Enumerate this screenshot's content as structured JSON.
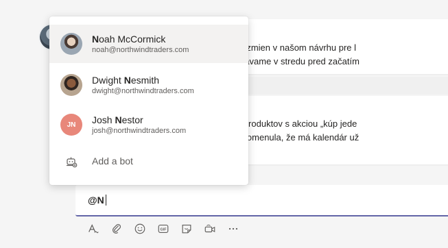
{
  "messages": {
    "line1": "ient mal niekoľko zmien v našom návrhu pre l",
    "line2": "ěto úpravy vykonávame v stredu pred začatím",
    "line3": "ody majú sekciu produktov s akciou „kúp jede",
    "line4": "ala august, ale spomenula, že má kalendár už"
  },
  "mention_popup": {
    "people": [
      {
        "name_bold": "N",
        "name_rest": "oah McCormick",
        "email": "noah@northwindtraders.com",
        "selected": true
      },
      {
        "name_pre": "Dwight ",
        "name_bold": "N",
        "name_rest": "esmith",
        "email": "dwight@northwindtraders.com"
      },
      {
        "name_pre": "Josh ",
        "name_bold": "N",
        "name_rest": "estor",
        "email": "josh@northwindtraders.com",
        "initials": "JN"
      }
    ],
    "add_bot_label": "Add a bot"
  },
  "compose": {
    "text": "@N"
  },
  "toolbar": {
    "icons": [
      "format-icon",
      "attach-icon",
      "emoji-icon",
      "gif-icon",
      "sticker-icon",
      "meet-now-icon",
      "more-options-icon"
    ],
    "gif_label": "GIF"
  },
  "colors": {
    "accent": "#6264a7",
    "josh_avatar": "#e8877a",
    "selected_bg": "#f3f2f1"
  }
}
